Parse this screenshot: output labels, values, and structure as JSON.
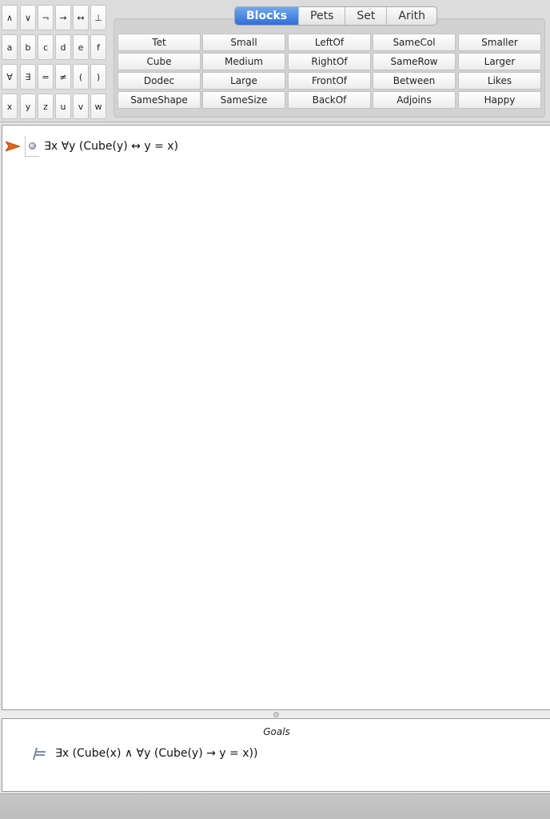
{
  "symbols": {
    "connectives": [
      "∧",
      "∨",
      "¬",
      "→",
      "↔",
      "⊥"
    ],
    "names": [
      "a",
      "b",
      "c",
      "d",
      "e",
      "f"
    ],
    "quantifiers": [
      "∀",
      "∃",
      "=",
      "≠",
      "(",
      ")"
    ],
    "variables": [
      "x",
      "y",
      "z",
      "u",
      "v",
      "w"
    ]
  },
  "tabs": [
    {
      "label": "Blocks",
      "active": true
    },
    {
      "label": "Pets",
      "active": false
    },
    {
      "label": "Set",
      "active": false
    },
    {
      "label": "Arith",
      "active": false
    }
  ],
  "predicates": [
    [
      "Tet",
      "Small",
      "LeftOf",
      "SameCol",
      "Smaller"
    ],
    [
      "Cube",
      "Medium",
      "RightOf",
      "SameRow",
      "Larger"
    ],
    [
      "Dodec",
      "Large",
      "FrontOf",
      "Between",
      "Likes"
    ],
    [
      "SameShape",
      "SameSize",
      "BackOf",
      "Adjoins",
      "Happy"
    ]
  ],
  "sentences": [
    {
      "text": "∃x ∀y (Cube(y) ↔ y = x)",
      "pointer_icon": "arrow-pointer-icon",
      "status_icon": "gray-dot-icon"
    }
  ],
  "goals": {
    "title": "Goals",
    "items": [
      {
        "text": "∃x (Cube(x) ∧ ∀y (Cube(y) → y = x))",
        "icon": "turnstile-icon"
      }
    ]
  },
  "colors": {
    "accent": "#3a78dc",
    "pointer": "#e4631a"
  }
}
